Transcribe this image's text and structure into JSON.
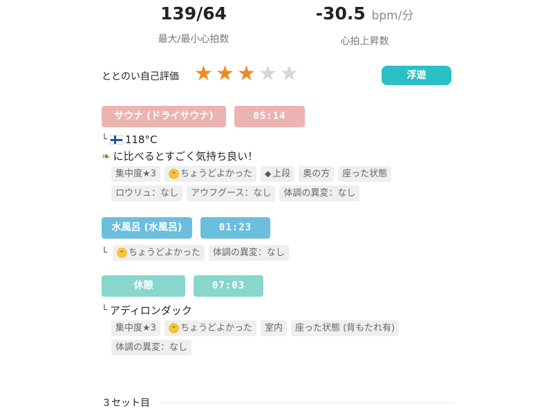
{
  "summary": {
    "heart_rate": {
      "value": "139/64",
      "label": "最大/最小心拍数"
    },
    "rise": {
      "value": "-30.5",
      "unit": "bpm/分",
      "label": "心拍上昇数"
    }
  },
  "rating": {
    "label": "ととのい自己評価",
    "stars": 3,
    "max_stars": 5,
    "star_on_color": "#f08a1e",
    "star_off_color": "#d6d6d6",
    "mood_badge": "浮遊"
  },
  "sauna": {
    "name": "サウナ (ドライサウナ)",
    "time": "05:14",
    "temperature": "118°C",
    "flag_icon": "finland-flag-icon",
    "memo_icon": "leaf-icon",
    "memo": "に比べるとすごく気持ち良い！",
    "tags_row1": [
      "集中度★3",
      "ちょうどよかった",
      "上段",
      "奥の方",
      "座った状態"
    ],
    "tags_row2": [
      "ロウリュ：なし",
      "アウフグース：なし",
      "体調の異変：なし"
    ]
  },
  "water": {
    "name": "水風呂 (水風呂)",
    "time": "01:23",
    "tags": [
      "ちょうどよかった",
      "体調の異変：なし"
    ]
  },
  "rest": {
    "name": "休憩",
    "time": "07:03",
    "place": "アディロンダック",
    "tags_row1": [
      "集中度★3",
      "ちょうどよかった",
      "室内",
      "座った状態 (背もたれ有)"
    ],
    "tags_row2": [
      "体調の異変：なし"
    ]
  },
  "next_set": {
    "label": "３セット目"
  },
  "colors": {
    "sauna": "#ecb3b3",
    "water": "#6cbedf",
    "rest": "#88d6cc",
    "badge": "#2bbfc6"
  }
}
